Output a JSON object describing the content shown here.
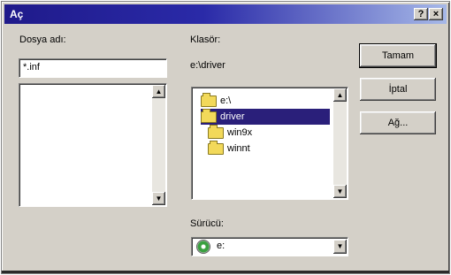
{
  "window": {
    "title": "Aç",
    "help_btn": "?",
    "close_btn": "×"
  },
  "filename": {
    "label": "Dosya adı:",
    "value": "*.inf"
  },
  "folders": {
    "label": "Klasör:",
    "current_path": "e:\\driver",
    "tree": [
      {
        "label": "e:\\",
        "selected": false
      },
      {
        "label": "driver",
        "selected": true
      },
      {
        "label": "win9x",
        "selected": false
      },
      {
        "label": "winnt",
        "selected": false
      }
    ]
  },
  "drives": {
    "label": "Sürücü:",
    "selected": "e:"
  },
  "buttons": {
    "ok": "Tamam",
    "cancel": "İptal",
    "network": "Ağ..."
  }
}
